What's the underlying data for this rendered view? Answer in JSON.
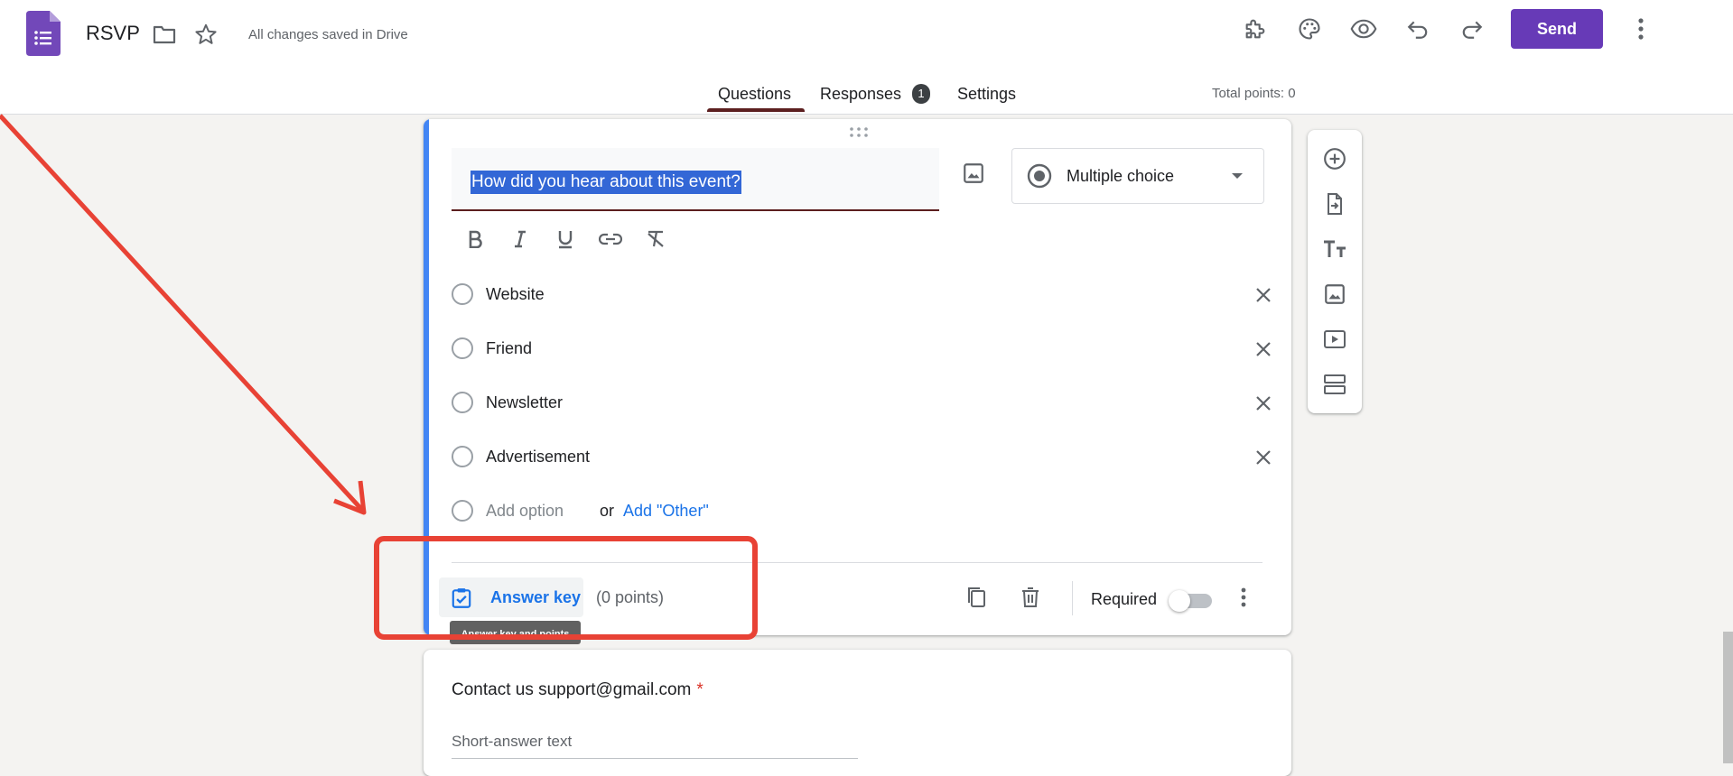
{
  "header": {
    "title": "RSVP",
    "saved_status": "All changes saved in Drive",
    "send_label": "Send"
  },
  "tabs": [
    {
      "label": "Questions",
      "active": true
    },
    {
      "label": "Responses",
      "badge": "1"
    },
    {
      "label": "Settings"
    }
  ],
  "total_points": "Total points: 0",
  "question": {
    "title": "How did you hear about this event?",
    "type": "Multiple choice",
    "options": [
      "Website",
      "Friend",
      "Newsletter",
      "Advertisement"
    ],
    "add_option": "Add option",
    "or": "or",
    "add_other": "Add \"Other\"",
    "answer_key_label": "Answer key",
    "points": "(0 points)",
    "tooltip": "Answer key and points",
    "required_label": "Required"
  },
  "next_question": {
    "title": "Contact us support@gmail.com",
    "required_mark": "*",
    "placeholder": "Short-answer text"
  },
  "colors": {
    "brand": "#673ab7",
    "accent": "#4285f4",
    "link": "#1a73e8",
    "annotation": "#e84235"
  },
  "icons": [
    "forms-logo-icon",
    "folder-icon",
    "star-icon",
    "addon-icon",
    "palette-icon",
    "preview-eye-icon",
    "undo-icon",
    "redo-icon",
    "more-vert-icon",
    "drag-handle-icon",
    "image-icon",
    "radio-icon",
    "chevron-down-icon",
    "bold-icon",
    "italic-icon",
    "underline-icon",
    "link-icon",
    "clear-format-icon",
    "close-icon",
    "answer-key-icon",
    "copy-icon",
    "delete-icon",
    "add-circle-icon",
    "import-icon",
    "title-icon",
    "video-icon",
    "section-icon"
  ]
}
